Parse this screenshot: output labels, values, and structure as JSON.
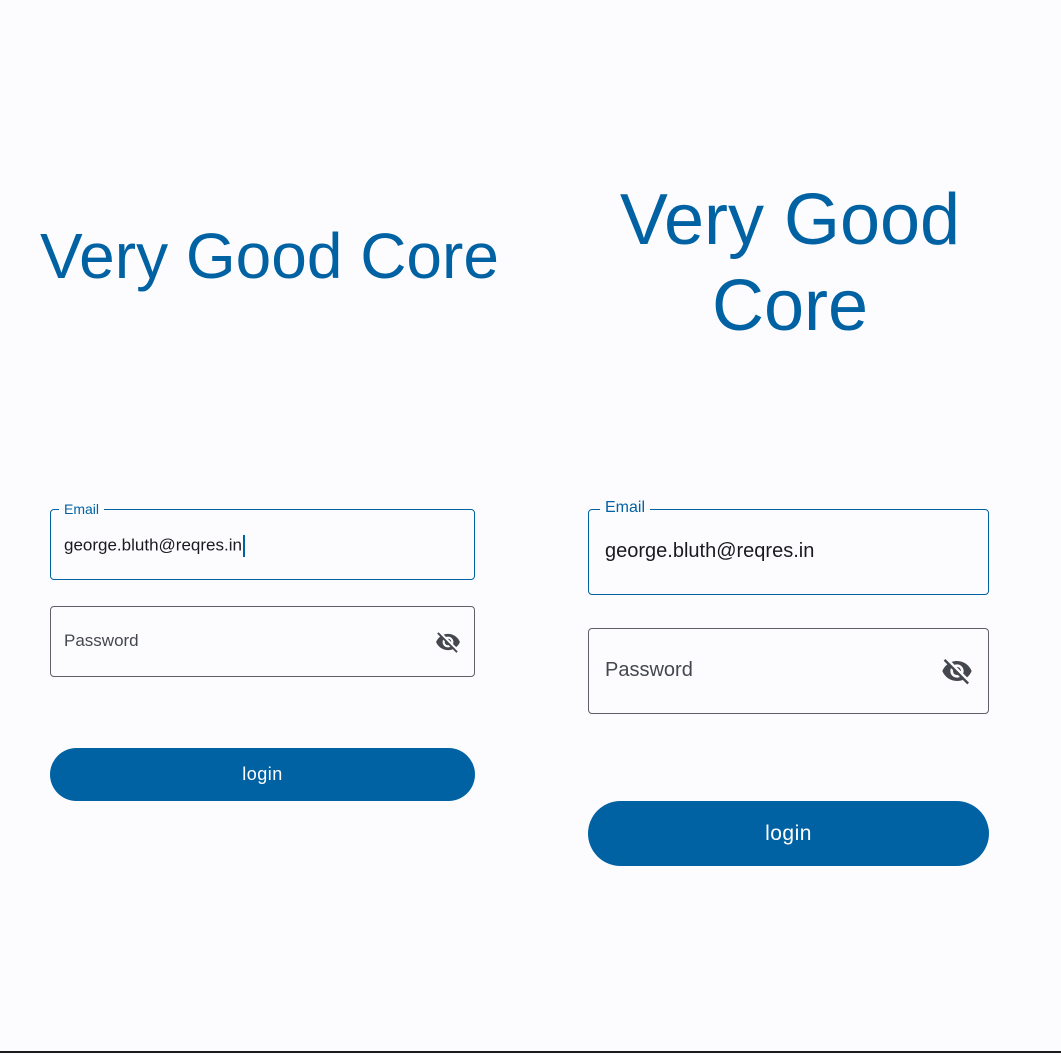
{
  "app": {
    "title": "Very Good Core"
  },
  "login_form": {
    "email_label": "Email",
    "email_value": "george.bluth@reqres.in",
    "password_placeholder": "Password",
    "password_visibility_icon": "visibility-off-icon",
    "login_label": "login"
  },
  "colors": {
    "primary": "#0062a3",
    "background": "#fcfcff",
    "outline": "#5f6168",
    "on_surface": "#1b1b1f",
    "on_primary": "#ffffff"
  }
}
